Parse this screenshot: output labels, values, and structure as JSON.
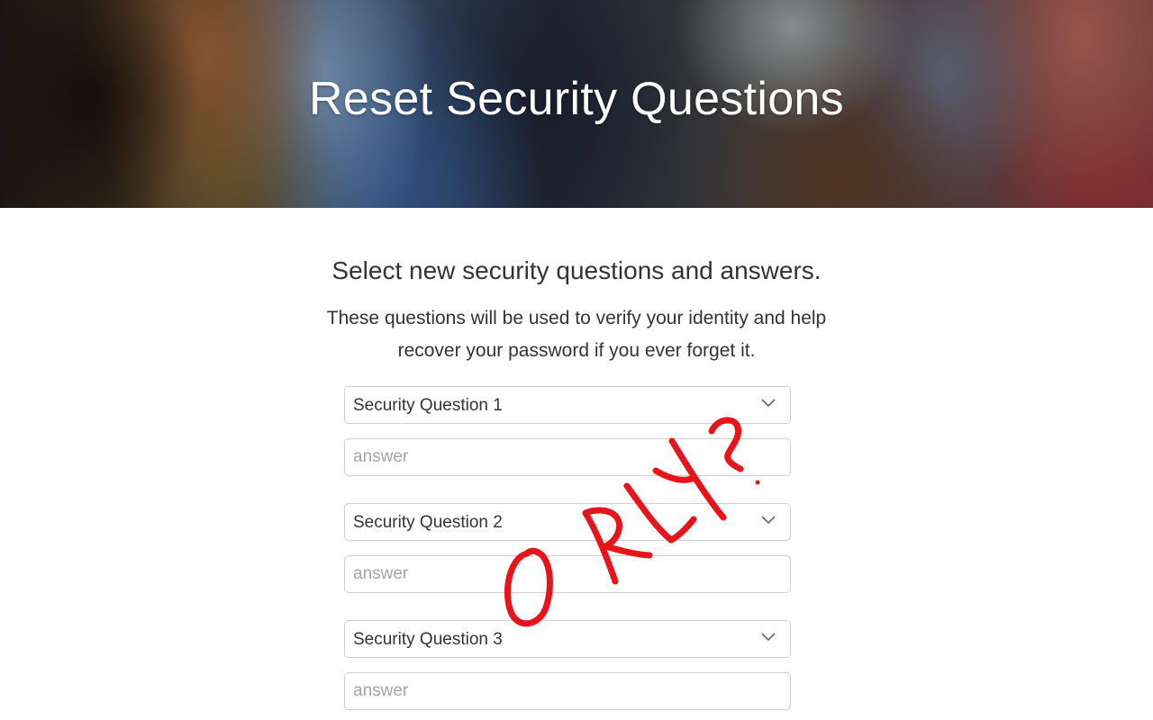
{
  "header": {
    "title": "Reset Security Questions"
  },
  "intro": {
    "subtitle": "Select new security questions and answers.",
    "description_line1": "These questions will be used to verify your identity and help",
    "description_line2": "recover your password if you ever forget it."
  },
  "questions": [
    {
      "select_label": "Security Question 1",
      "answer_placeholder": "answer",
      "answer_value": ""
    },
    {
      "select_label": "Security Question 2",
      "answer_placeholder": "answer",
      "answer_value": ""
    },
    {
      "select_label": "Security Question 3",
      "answer_placeholder": "answer",
      "answer_value": ""
    }
  ],
  "annotation": {
    "text": "O RLY?",
    "color": "#e8141c"
  },
  "icons": {
    "select_chevron": "chevron-down-icon"
  }
}
